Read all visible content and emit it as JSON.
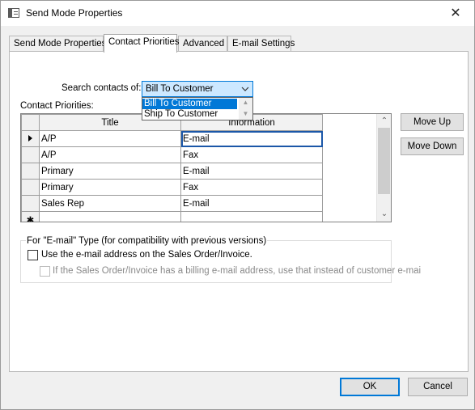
{
  "window": {
    "title": "Send Mode Properties",
    "close_glyph": "✕"
  },
  "tabs": [
    {
      "label": "Send Mode Properties",
      "active": false
    },
    {
      "label": "Contact Priorities",
      "active": true
    },
    {
      "label": "Advanced",
      "active": false
    },
    {
      "label": "E-mail Settings",
      "active": false
    }
  ],
  "search": {
    "label": "Search contacts of:",
    "selected": "Bill To Customer",
    "options": [
      "Bill To Customer",
      "Ship To Customer"
    ]
  },
  "grid": {
    "label": "Contact Priorities:",
    "columns": [
      "Title",
      "Information"
    ],
    "rows": [
      {
        "title": "A/P",
        "information": "E-mail",
        "current": true
      },
      {
        "title": "A/P",
        "information": "Fax",
        "current": false
      },
      {
        "title": "Primary",
        "information": "E-mail",
        "current": false
      },
      {
        "title": "Primary",
        "information": "Fax",
        "current": false
      },
      {
        "title": "Sales Rep",
        "information": "E-mail",
        "current": false
      }
    ],
    "new_row_marker": "✱"
  },
  "buttons": {
    "move_up": "Move Up",
    "move_down": "Move Down",
    "ok": "OK",
    "cancel": "Cancel"
  },
  "email_group": {
    "title": "For \"E-mail\" Type (for compatibility with previous versions)",
    "use_sales_order_label": "Use the e-mail address on the Sales Order/Invoice.",
    "use_sales_order_checked": false,
    "billing_label": "If the Sales Order/Invoice has a billing e-mail address, use that instead of customer e-mai",
    "billing_checked": false,
    "billing_enabled": false
  }
}
